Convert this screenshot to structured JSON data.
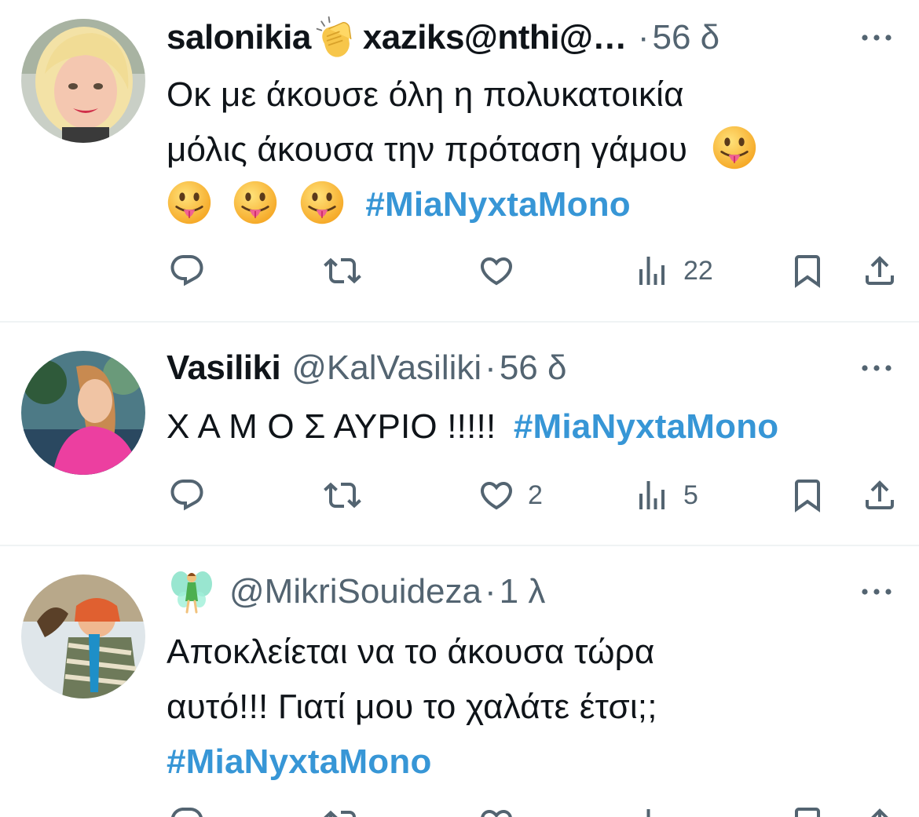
{
  "tweets": [
    {
      "name": "salonikia",
      "name_suffix": "xaziks@nthi@…",
      "name_emoji": "clapping-hands",
      "time": "56 δ",
      "text_line1": "Οκ με άκουσε όλη η πολυκατοικία",
      "text_line2": "μόλις άκουσα την πρόταση γάμου",
      "text_emoji": "tongue-out-face",
      "hashtag": "#MiaNyxtaMono",
      "views": "22",
      "likes": ""
    },
    {
      "name": "Vasiliki",
      "handle": "@KalVasiliki",
      "time": "56 δ",
      "text": "Χ Α Μ Ο Σ ΑΥΡΙΟ !!!!!",
      "hashtag": "#MiaNyxtaMono",
      "likes": "2",
      "views": "5"
    },
    {
      "name_emoji": "fairy",
      "handle": "@MikriSouideza",
      "time": "1 λ",
      "text_line1": "Αποκλείεται να το άκουσα τώρα",
      "text_line2": "αυτό!!! Γιατί μου το χαλάτε έτσι;;",
      "hashtag": "#MiaNyxtaMono"
    }
  ],
  "separator": "·",
  "colors": {
    "text": "#0f1419",
    "secondary": "#536471",
    "link": "#1d9bf0",
    "divider": "#eff3f4"
  }
}
